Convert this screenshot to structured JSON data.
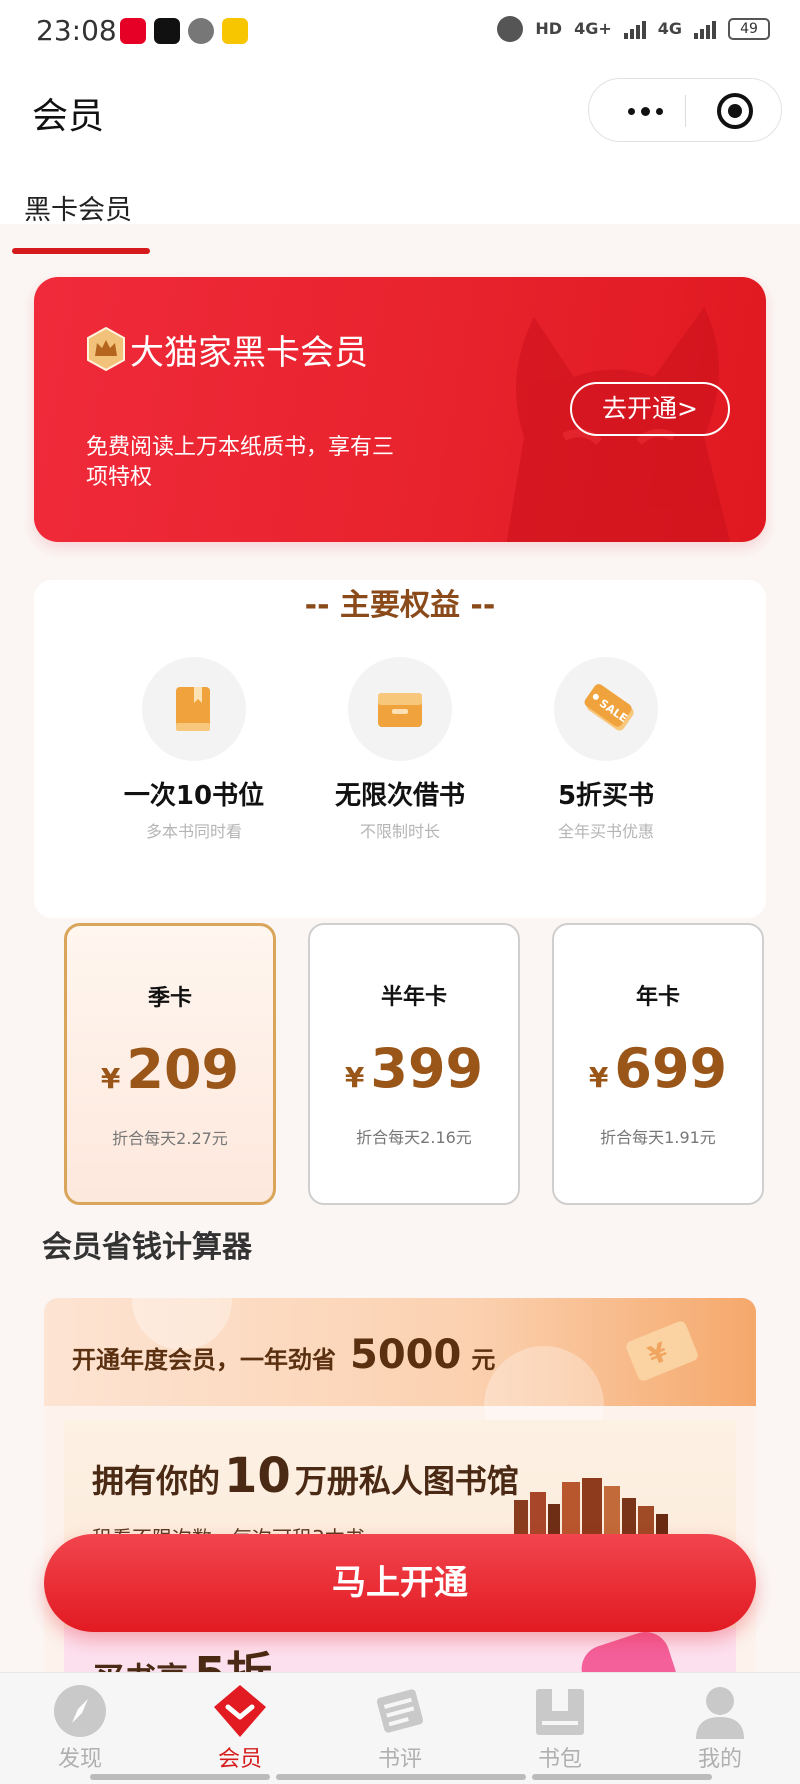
{
  "status_bar": {
    "time": "23:08",
    "network_1": "HD",
    "network_2": "4G+",
    "network_3": "4G",
    "battery": "49"
  },
  "header": {
    "title": "会员",
    "tab": "黑卡会员"
  },
  "banner": {
    "title": "大猫家黑卡会员",
    "description": "免费阅读上万本纸质书，享有三项特权",
    "button": "去开通>"
  },
  "benefits": {
    "title": "-- 主要权益 --",
    "items": [
      {
        "icon": "book-icon",
        "name": "一次10书位",
        "sub": "多本书同时看"
      },
      {
        "icon": "box-icon",
        "name": "无限次借书",
        "sub": "不限制时长"
      },
      {
        "icon": "sale-tag-icon",
        "name": "5折买书",
        "sub": "全年买书优惠"
      }
    ]
  },
  "plans": [
    {
      "name": "季卡",
      "currency": "¥",
      "price": "209",
      "daily": "折合每天2.27元",
      "selected": true
    },
    {
      "name": "半年卡",
      "currency": "¥",
      "price": "399",
      "daily": "折合每天2.16元",
      "selected": false
    },
    {
      "name": "年卡",
      "currency": "¥",
      "price": "699",
      "daily": "折合每天1.91元",
      "selected": false
    }
  ],
  "calculator": {
    "title": "会员省钱计算器",
    "headline_prefix": "开通年度会员，一年劲省",
    "headline_amount": "5000",
    "headline_unit": "元",
    "library_prefix": "拥有你的",
    "library_number": "10",
    "library_suffix": "万册私人图书馆",
    "rent_note": "租看不限次数，每次可租3本书",
    "buy_prefix": "买书享",
    "buy_number": "5折"
  },
  "cta": "马上开通",
  "tabbar": [
    {
      "label": "发现",
      "icon": "compass-icon",
      "active": false
    },
    {
      "label": "会员",
      "icon": "member-diamond-icon",
      "active": true
    },
    {
      "label": "书评",
      "icon": "review-icon",
      "active": false
    },
    {
      "label": "书包",
      "icon": "bookbag-icon",
      "active": false
    },
    {
      "label": "我的",
      "icon": "profile-icon",
      "active": false
    }
  ],
  "colors": {
    "brand_red": "#e21a22",
    "gold": "#9a5518",
    "selected_border": "#d9a55a"
  }
}
